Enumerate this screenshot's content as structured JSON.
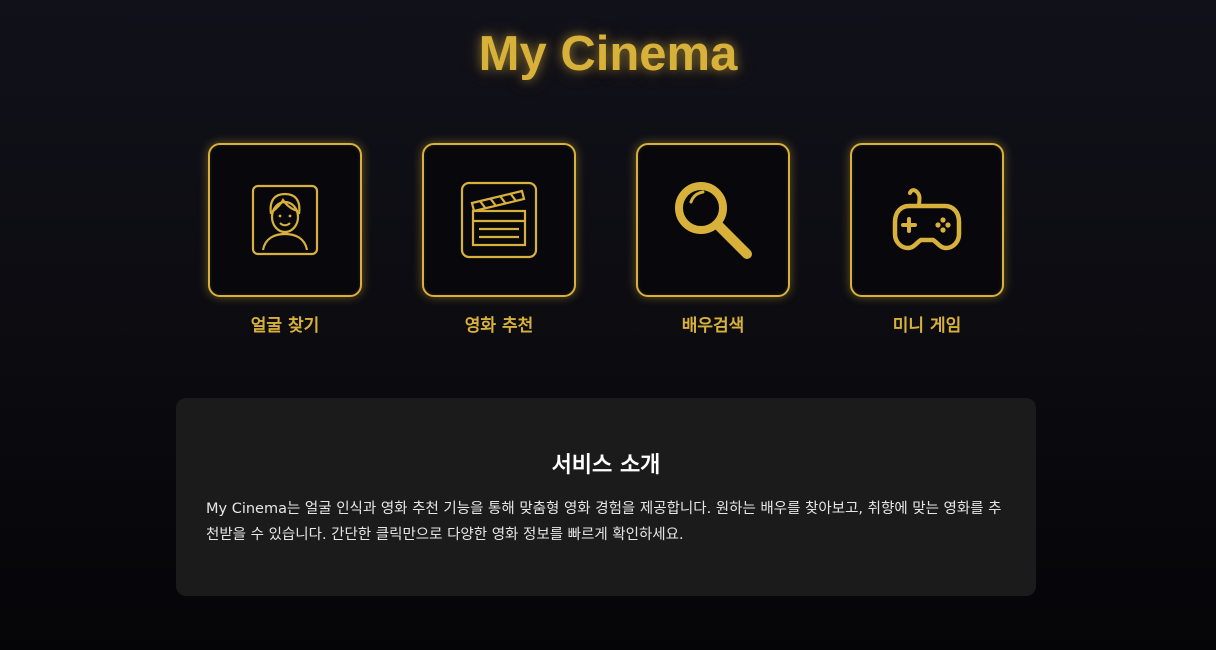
{
  "header": {
    "title": "My Cinema"
  },
  "menu": {
    "items": [
      {
        "label": "얼굴 찾기",
        "icon": "face-portrait-icon"
      },
      {
        "label": "영화 추천",
        "icon": "clapperboard-icon"
      },
      {
        "label": "배우검색",
        "icon": "magnifier-icon"
      },
      {
        "label": "미니 게임",
        "icon": "gamepad-icon"
      }
    ]
  },
  "about": {
    "title": "서비스 소개",
    "text": "My Cinema는 얼굴 인식과 영화 추천 기능을 통해 맞춤형 영화 경험을 제공합니다. 원하는 배우를 찾아보고, 취향에 맞는 영화를 추천받을 수 있습니다. 간단한 클릭만으로 다양한 영화 정보를 빠르게 확인하세요."
  },
  "colors": {
    "accent": "#d8b13a",
    "background": "#0b0b10",
    "panel": "#1b1b1b",
    "text": "#ffffff"
  }
}
